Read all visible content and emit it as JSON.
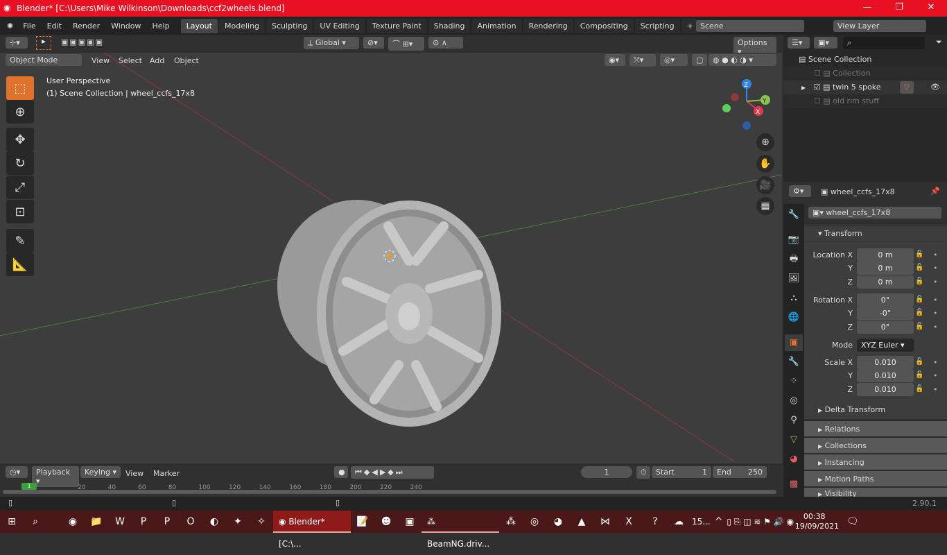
{
  "window": {
    "title": "Blender* [C:\\Users\\Mike Wilkinson\\Downloads\\ccf2wheels.blend]",
    "minimize": "—",
    "maximize": "❐",
    "close": "✕"
  },
  "menubar": {
    "items": [
      "File",
      "Edit",
      "Render",
      "Window",
      "Help"
    ],
    "workspaces": [
      "Layout",
      "Modeling",
      "Sculpting",
      "UV Editing",
      "Texture Paint",
      "Shading",
      "Animation",
      "Rendering",
      "Compositing",
      "Scripting"
    ],
    "active_workspace": "Layout",
    "add_workspace": "+",
    "scene": "Scene",
    "view_layer": "View Layer"
  },
  "header": {
    "orientation": "Global",
    "options": "Options",
    "mode": "Object Mode",
    "menus": [
      "View",
      "Select",
      "Add",
      "Object"
    ]
  },
  "viewport": {
    "perspective": "User Perspective",
    "context": "(1) Scene Collection | wheel_ccfs_17x8",
    "axes": {
      "x": "X",
      "y": "Y",
      "z": "Z"
    },
    "colors": {
      "x": "#e0374f",
      "y": "#8bc34a",
      "z": "#2f85e4",
      "grid_x": "#8a3a3a",
      "grid_y": "#4a7a3a"
    }
  },
  "outliner": {
    "root": "Scene Collection",
    "items": [
      {
        "label": "Collection",
        "checked": false,
        "enabled": false
      },
      {
        "label": "twin 5 spoke",
        "checked": true,
        "enabled": true
      },
      {
        "label": "old rim stuff",
        "checked": false,
        "enabled": false
      }
    ]
  },
  "properties": {
    "object_name": "wheel_ccfs_17x8",
    "data_name": "wheel_ccfs_17x8",
    "transform_label": "Transform",
    "location": {
      "label": "Location X",
      "rows": [
        {
          "axis": "Location X",
          "value": "0 m"
        },
        {
          "axis": "Y",
          "value": "0 m"
        },
        {
          "axis": "Z",
          "value": "0 m"
        }
      ]
    },
    "rotation": {
      "rows": [
        {
          "axis": "Rotation X",
          "value": "0°"
        },
        {
          "axis": "Y",
          "value": "-0°"
        },
        {
          "axis": "Z",
          "value": "0°"
        }
      ]
    },
    "mode_label": "Mode",
    "mode_value": "XYZ Euler",
    "scale": {
      "rows": [
        {
          "axis": "Scale X",
          "value": "0.010"
        },
        {
          "axis": "Y",
          "value": "0.010"
        },
        {
          "axis": "Z",
          "value": "0.010"
        }
      ]
    },
    "delta": "Delta Transform",
    "panels": [
      "Relations",
      "Collections",
      "Instancing",
      "Motion Paths",
      "Visibility"
    ]
  },
  "timeline": {
    "menus": [
      "Playback",
      "Keying",
      "View",
      "Marker"
    ],
    "current_frame": "1",
    "start_label": "Start",
    "start": "1",
    "end_label": "End",
    "end": "250",
    "ticks": [
      "20",
      "40",
      "60",
      "80",
      "100",
      "120",
      "140",
      "160",
      "180",
      "200",
      "220",
      "240"
    ],
    "playhead": "1"
  },
  "status": {
    "version": "2.90.1"
  },
  "taskbar": {
    "blender": "Blender* [C:\\...",
    "beamng": "BeamNG.driv...",
    "weather": "15...",
    "time": "00:38",
    "date": "19/09/2021"
  }
}
